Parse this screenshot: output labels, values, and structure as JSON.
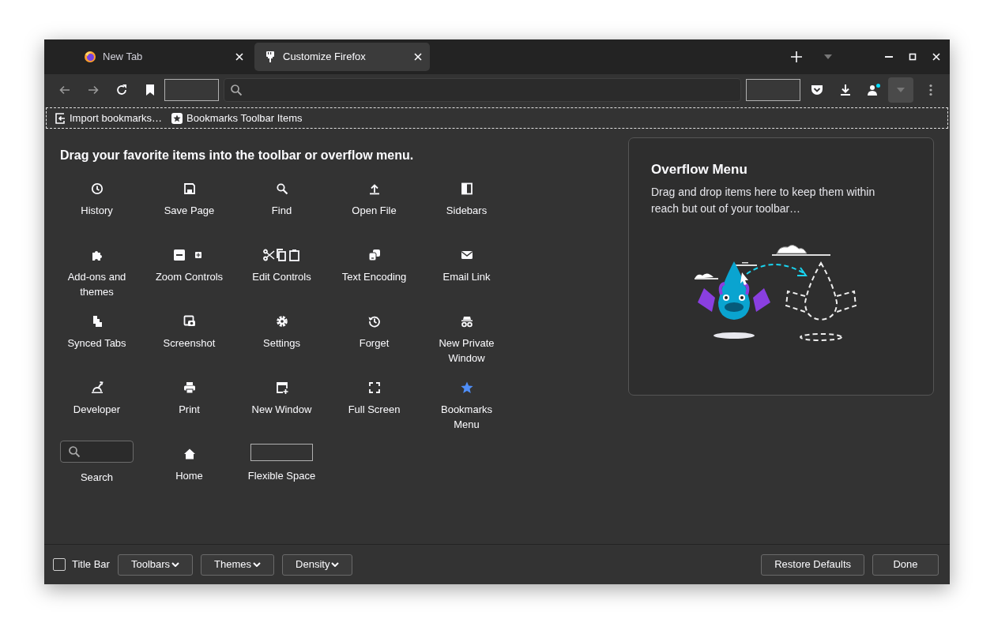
{
  "tabs": [
    {
      "title": "New Tab",
      "selected": false
    },
    {
      "title": "Customize Firefox",
      "selected": true
    }
  ],
  "bookmarks_toolbar": [
    {
      "label": "Import bookmarks…"
    },
    {
      "label": "Bookmarks Toolbar Items"
    }
  ],
  "palette": {
    "heading": "Drag your favorite items into the toolbar or overflow menu.",
    "items": [
      {
        "label": "History",
        "kind": "button"
      },
      {
        "label": "Save Page",
        "kind": "button"
      },
      {
        "label": "Find",
        "kind": "button"
      },
      {
        "label": "Open File",
        "kind": "button"
      },
      {
        "label": "Sidebars",
        "kind": "button"
      },
      {
        "label": "Add-ons and themes",
        "kind": "button"
      },
      {
        "label": "Zoom Controls",
        "kind": "button"
      },
      {
        "label": "Edit Controls",
        "kind": "button"
      },
      {
        "label": "Text Encoding",
        "kind": "button"
      },
      {
        "label": "Email Link",
        "kind": "button"
      },
      {
        "label": "Synced Tabs",
        "kind": "button"
      },
      {
        "label": "Screenshot",
        "kind": "button"
      },
      {
        "label": "Settings",
        "kind": "button"
      },
      {
        "label": "Forget",
        "kind": "button"
      },
      {
        "label": "New Private Window",
        "kind": "button"
      },
      {
        "label": "Developer",
        "kind": "button"
      },
      {
        "label": "Print",
        "kind": "button"
      },
      {
        "label": "New Window",
        "kind": "button"
      },
      {
        "label": "Full Screen",
        "kind": "button"
      },
      {
        "label": "Bookmarks Menu",
        "kind": "button"
      },
      {
        "label": "Search",
        "kind": "search"
      },
      {
        "label": "Home",
        "kind": "button"
      },
      {
        "label": "Flexible Space",
        "kind": "space"
      }
    ]
  },
  "overflow_menu": {
    "title": "Overflow Menu",
    "description": "Drag and drop items here to keep them within reach but out of your toolbar…"
  },
  "footer": {
    "title_bar": {
      "label": "Title Bar",
      "checked": false
    },
    "menus": [
      "Toolbars",
      "Themes",
      "Density"
    ],
    "buttons": [
      "Restore Defaults",
      "Done"
    ]
  }
}
